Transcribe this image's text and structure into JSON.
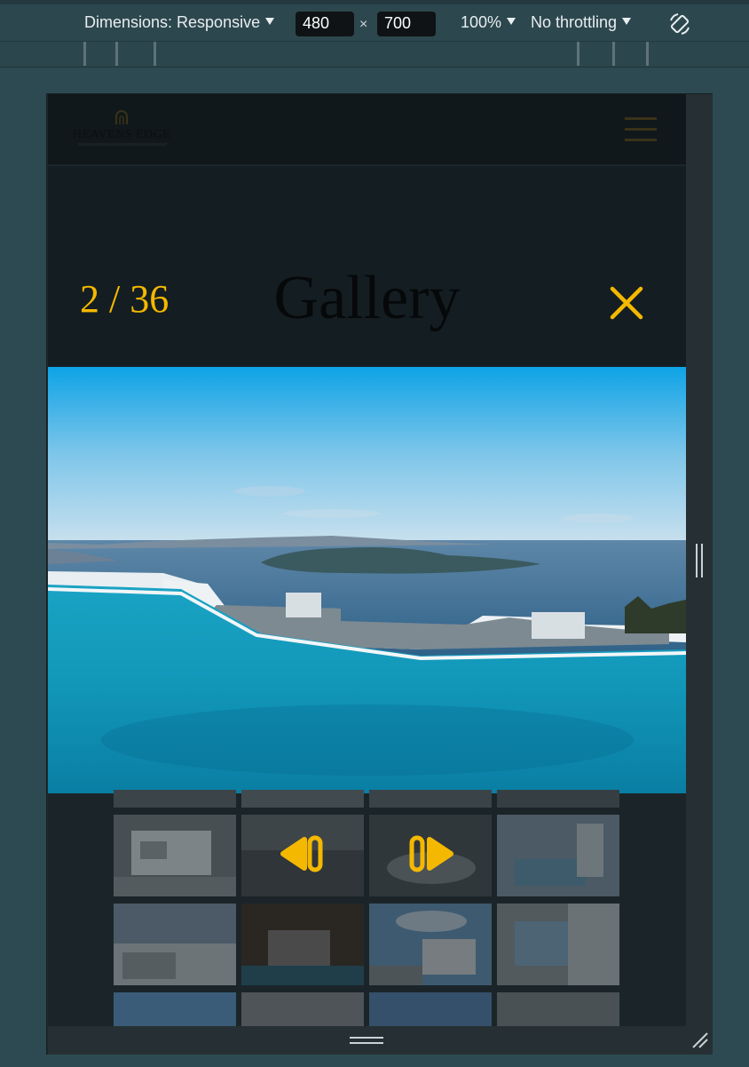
{
  "devtools": {
    "dimensions_label": "Dimensions: Responsive",
    "width_value": "480",
    "height_value": "700",
    "times_symbol": "×",
    "zoom_label": "100%",
    "throttle_label": "No throttling",
    "rotate_icon": "rotate-device-icon"
  },
  "site": {
    "logo_text": "HEAVENS EDGE",
    "menu_icon": "hamburger-menu-icon"
  },
  "lightbox": {
    "counter": "2 / 36",
    "title": "Gallery",
    "close_icon": "close-icon",
    "prev_icon": "previous-arrow-icon",
    "next_icon": "next-arrow-icon"
  },
  "colors": {
    "accent": "#f5b800",
    "devtools_bg": "#2d474e",
    "page_bg": "#141c20"
  }
}
